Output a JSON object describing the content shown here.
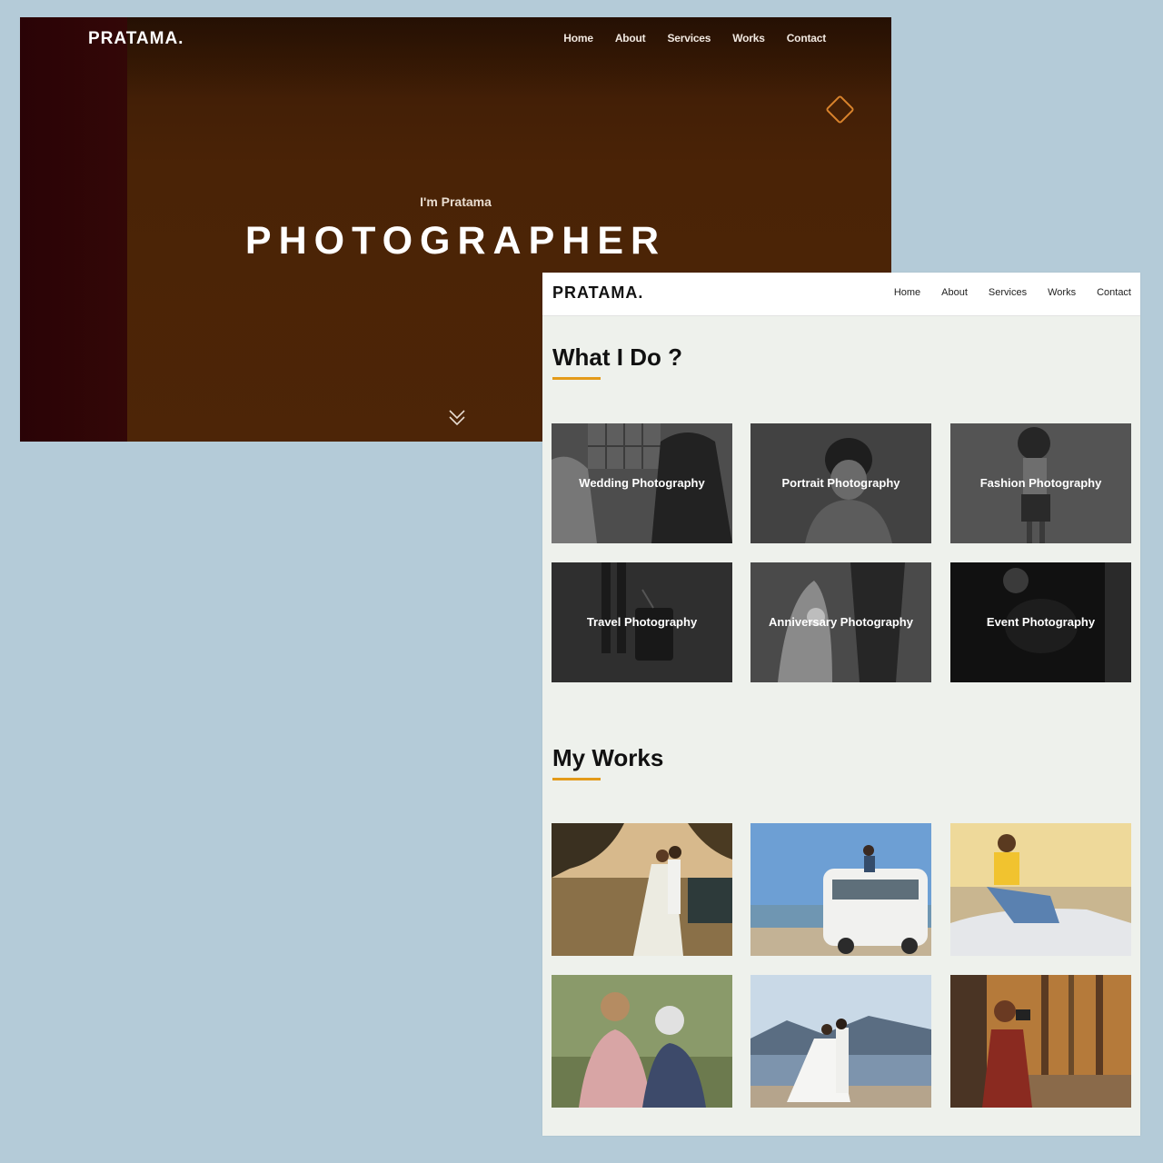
{
  "hero": {
    "logo": "PRATAMA.",
    "nav": [
      "Home",
      "About",
      "Services",
      "Works",
      "Contact"
    ],
    "intro": "I'm Pratama",
    "title": "PHOTOGRAPHER"
  },
  "page": {
    "logo": "PRATAMA.",
    "nav": [
      "Home",
      "About",
      "Services",
      "Works",
      "Contact"
    ],
    "services_title": "What I Do ?",
    "services": [
      "Wedding Photography",
      "Portrait Photography",
      "Fashion Photography",
      "Travel Photography",
      "Anniversary Photography",
      "Event Photography"
    ],
    "works_title": "My Works"
  },
  "colors": {
    "accent": "#e39a19",
    "hero_bg": "#4a2306",
    "page_bg": "#eef1ec"
  }
}
